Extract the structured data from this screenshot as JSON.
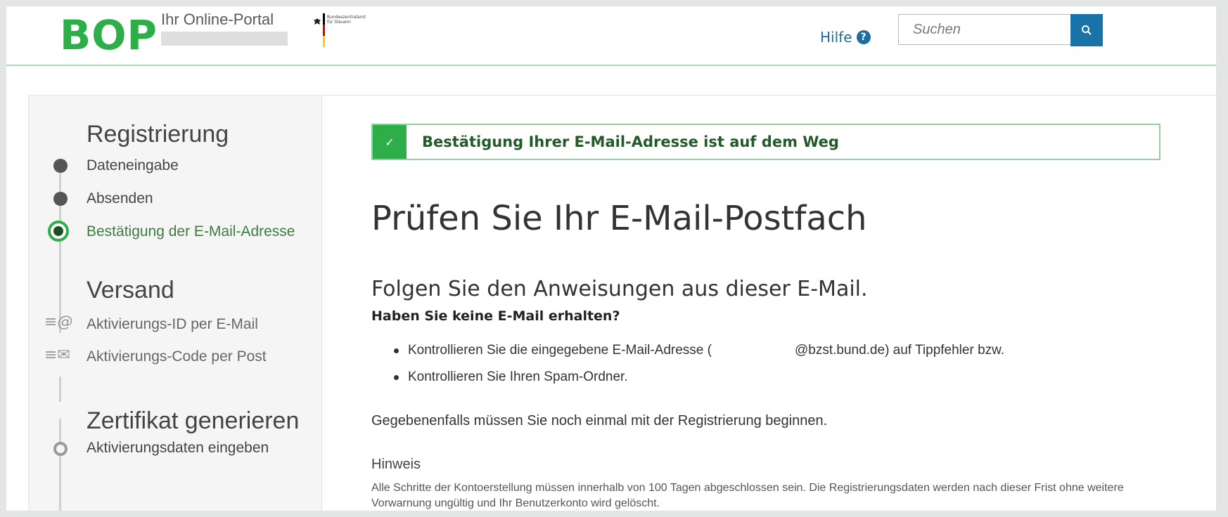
{
  "header": {
    "logo": "BOP",
    "tagline": "Ihr Online-Portal",
    "agency_text": "Bundeszentralamt für Steuern",
    "help_label": "Hilfe",
    "help_icon": "question-circle-icon",
    "search_placeholder": "Suchen",
    "search_icon": "search-icon"
  },
  "sidebar": {
    "sections": [
      {
        "title": "Registrierung",
        "items": [
          {
            "label": "Dateneingabe",
            "state": "done"
          },
          {
            "label": "Absenden",
            "state": "done"
          },
          {
            "label": "Bestätigung der E-Mail-Adresse",
            "state": "active"
          }
        ]
      },
      {
        "title": "Versand",
        "items": [
          {
            "label": "Aktivierungs-ID per E-Mail",
            "icon": "email-at-icon"
          },
          {
            "label": "Aktivierungs-Code per Post",
            "icon": "letter-icon"
          }
        ]
      },
      {
        "title": "Zertifikat generieren",
        "items": [
          {
            "label": "Aktivierungsdaten eingeben",
            "state": "pending"
          }
        ]
      }
    ]
  },
  "main": {
    "alert": "Bestätigung Ihrer E-Mail-Adresse ist auf dem Weg",
    "alert_icon": "checkmark-icon",
    "title": "Prüfen Sie Ihr E-Mail-Postfach",
    "subtitle": "Folgen Sie den Anweisungen aus dieser E-Mail.",
    "question": "Haben Sie keine E-Mail erhalten?",
    "list": {
      "item1_prefix": "Kontrollieren Sie die eingegebene E-Mail-Adresse (",
      "item1_email_domain": "@bzst.bund.de",
      "item1_suffix": ") auf Tippfehler bzw.",
      "item2": "Kontrollieren Sie Ihren Spam-Ordner."
    },
    "paragraph": "Gegebenenfalls müssen Sie noch einmal mit der Registrierung beginnen.",
    "note_title": "Hinweis",
    "note_text": "Alle Schritte der Kontoerstellung müssen innerhalb von 100 Tagen abgeschlossen sein. Die Registrierungsdaten werden nach dieser Frist ohne weitere Vorwarnung ungültig und Ihr Benutzerkonto wird gelöscht."
  },
  "colors": {
    "brand_green": "#2eae49",
    "link_blue": "#1a6fa0",
    "search_button": "#1a73a8",
    "active_step_text": "#3b7d3f"
  }
}
